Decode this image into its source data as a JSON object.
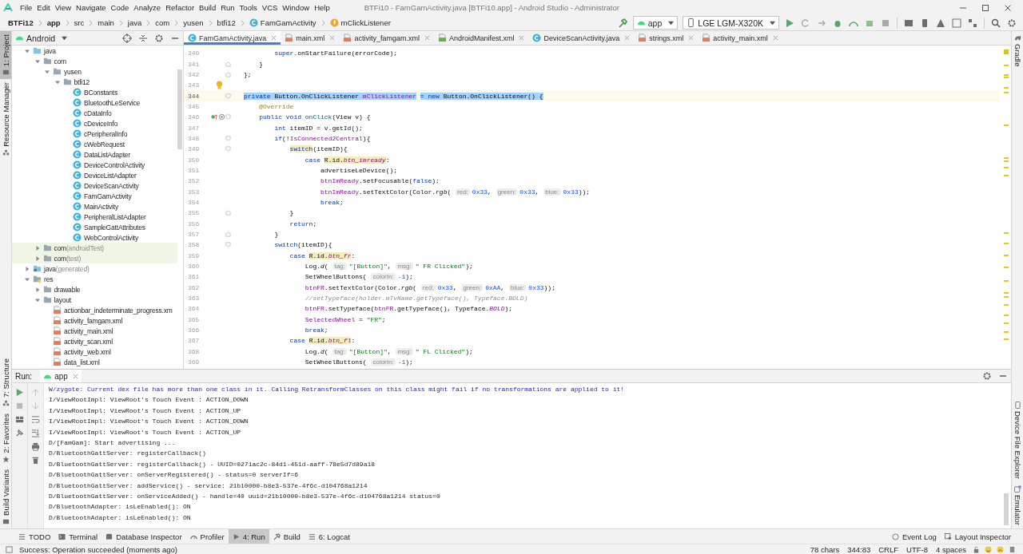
{
  "menu_bar": {
    "items": [
      "File",
      "Edit",
      "View",
      "Navigate",
      "Code",
      "Analyze",
      "Refactor",
      "Build",
      "Run",
      "Tools",
      "VCS",
      "Window",
      "Help"
    ],
    "title": "BTFi10 - FamGamActivity.java [BTFi10.app] - Android Studio - Administrator"
  },
  "navigation_bar": {
    "breadcrumbs": [
      {
        "label": "BTFi12",
        "kind": "bold"
      },
      {
        "label": "app",
        "kind": "bold"
      },
      {
        "label": "src",
        "kind": "plain"
      },
      {
        "label": "main",
        "kind": "plain"
      },
      {
        "label": "java",
        "kind": "plain"
      },
      {
        "label": "com",
        "kind": "plain"
      },
      {
        "label": "yusen",
        "kind": "plain"
      },
      {
        "label": "btfi12",
        "kind": "plain"
      },
      {
        "label": "FamGamActivity",
        "kind": "class"
      },
      {
        "label": "mClickListener",
        "kind": "field"
      }
    ],
    "run_config": "app",
    "device": "LGE LGM-X320K"
  },
  "left_stripe": {
    "top": [
      {
        "label": "1: Project",
        "kind": "project",
        "selected": true
      },
      {
        "label": "Resource Manager",
        "kind": "resources",
        "selected": false
      }
    ],
    "bottom": [
      {
        "label": "7: Structure",
        "kind": "structure",
        "selected": false
      },
      {
        "label": "2: Favorites",
        "kind": "favorites",
        "selected": false
      },
      {
        "label": "Build Variants",
        "kind": "build-variants",
        "selected": false
      }
    ]
  },
  "right_stripe": {
    "top": [
      {
        "label": "Gradle",
        "kind": "gradle",
        "selected": false
      }
    ],
    "bottom": [
      {
        "label": "Device File Explorer",
        "kind": "device-explorer",
        "selected": false
      },
      {
        "label": "Emulator",
        "kind": "emulator",
        "selected": false
      }
    ]
  },
  "project_panel": {
    "view": "Android",
    "tree": [
      {
        "label": "java",
        "kind": "source-folder",
        "expanded": true,
        "children": [
          {
            "label": "com",
            "kind": "package",
            "expanded": true,
            "children": [
              {
                "label": "yusen",
                "kind": "package",
                "expanded": true,
                "children": [
                  {
                    "label": "btfi12",
                    "kind": "package",
                    "expanded": true,
                    "children": [
                      {
                        "label": "BConstants",
                        "kind": "class"
                      },
                      {
                        "label": "BluetoothLeService",
                        "kind": "class"
                      },
                      {
                        "label": "cDataInfo",
                        "kind": "class"
                      },
                      {
                        "label": "cDeviceInfo",
                        "kind": "class"
                      },
                      {
                        "label": "cPeripheralInfo",
                        "kind": "class"
                      },
                      {
                        "label": "cWebRequest",
                        "kind": "class"
                      },
                      {
                        "label": "DataListAdapter",
                        "kind": "class"
                      },
                      {
                        "label": "DeviceControlActivity",
                        "kind": "class"
                      },
                      {
                        "label": "DeviceListAdapter",
                        "kind": "class"
                      },
                      {
                        "label": "DeviceScanActivity",
                        "kind": "class"
                      },
                      {
                        "label": "FamGamActivity",
                        "kind": "class"
                      },
                      {
                        "label": "MainActivity",
                        "kind": "class"
                      },
                      {
                        "label": "PeripheralListAdapter",
                        "kind": "class"
                      },
                      {
                        "label": "SampleGattAttributes",
                        "kind": "class"
                      },
                      {
                        "label": "WebControlActivity",
                        "kind": "class"
                      }
                    ]
                  }
                ]
              }
            ]
          },
          {
            "label": "com",
            "note": "(androidTest)",
            "kind": "test-package",
            "expanded": false
          },
          {
            "label": "com",
            "note": "(test)",
            "kind": "test-package",
            "expanded": false
          }
        ]
      },
      {
        "label": "java",
        "note": "(generated)",
        "kind": "generated-folder",
        "expanded": false
      },
      {
        "label": "res",
        "kind": "res-folder",
        "expanded": true,
        "children": [
          {
            "label": "drawable",
            "kind": "package",
            "expanded": false
          },
          {
            "label": "layout",
            "kind": "package",
            "expanded": true,
            "children": [
              {
                "label": "actionbar_indeterminate_progress.xm",
                "kind": "xml"
              },
              {
                "label": "activity_famgam.xml",
                "kind": "xml"
              },
              {
                "label": "activity_main.xml",
                "kind": "xml"
              },
              {
                "label": "activity_scan.xml",
                "kind": "xml"
              },
              {
                "label": "activity_web.xml",
                "kind": "xml"
              },
              {
                "label": "data_list.xml",
                "kind": "xml"
              }
            ]
          }
        ]
      }
    ]
  },
  "editor": {
    "tabs": [
      {
        "label": "FamGamActivity.java",
        "kind": "class",
        "selected": true
      },
      {
        "label": "main.xml",
        "kind": "xml",
        "selected": false
      },
      {
        "label": "activity_famgam.xml",
        "kind": "xml",
        "selected": false
      },
      {
        "label": "AndroidManifest.xml",
        "kind": "manifest",
        "selected": false
      },
      {
        "label": "DeviceScanActivity.java",
        "kind": "class",
        "selected": false
      },
      {
        "label": "strings.xml",
        "kind": "xml",
        "selected": false
      },
      {
        "label": "activity_main.xml",
        "kind": "xml",
        "selected": false
      }
    ],
    "lines": [
      {
        "num": "340",
        "selected": false,
        "tokens": [
          {
            "kind": "kw",
            "text": "        super"
          },
          {
            "kind": "p",
            "text": ".onStartFailure(errorCode);"
          }
        ]
      },
      {
        "num": "341",
        "selected": false,
        "gutter": [
          {
            "kind": "fold-end"
          }
        ],
        "tokens": [
          {
            "kind": "p",
            "text": "    }"
          }
        ]
      },
      {
        "num": "342",
        "selected": false,
        "gutter": [
          {
            "kind": "fold-end"
          }
        ],
        "tokens": [
          {
            "kind": "p",
            "text": "};"
          }
        ]
      },
      {
        "num": "343",
        "selected": false,
        "gutter": [
          {
            "kind": "bulb"
          }
        ]
      },
      {
        "num": "344",
        "selected": true,
        "gutter": [
          {
            "kind": "fold-start"
          }
        ],
        "tokens": [
          {
            "kind": "kw",
            "text": "private "
          },
          {
            "kind": "p",
            "text": "Button.OnClickListener "
          },
          {
            "kind": "fld",
            "text": "mClickListener"
          },
          {
            "kind": "p",
            "text": " = "
          },
          {
            "kind": "kw",
            "text": "new "
          },
          {
            "kind": "p",
            "text": "Button.OnClickListener() {"
          }
        ]
      },
      {
        "num": "345",
        "selected": false,
        "tokens": [
          {
            "kind": "ann",
            "text": "    @Override"
          }
        ]
      },
      {
        "num": "346",
        "selected": false,
        "gutter": [
          {
            "kind": "override"
          },
          {
            "kind": "fold-start"
          }
        ],
        "tokens": [
          {
            "kind": "kw",
            "text": "    public void "
          },
          {
            "kind": "mth",
            "text": "onClick"
          },
          {
            "kind": "p",
            "text": "(View v) {"
          }
        ]
      },
      {
        "num": "347",
        "selected": false,
        "tokens": [
          {
            "kind": "kw",
            "text": "        int "
          },
          {
            "kind": "p",
            "text": "itemID = v.getId();"
          }
        ]
      },
      {
        "num": "348",
        "selected": false,
        "gutter": [
          {
            "kind": "fold-start"
          }
        ],
        "tokens": [
          {
            "kind": "kw",
            "text": "        if"
          },
          {
            "kind": "p",
            "text": "(!"
          },
          {
            "kind": "fld",
            "text": "IsConnected2Central"
          },
          {
            "kind": "p",
            "text": "){"
          }
        ]
      },
      {
        "num": "349",
        "selected": false,
        "gutter": [
          {
            "kind": "fold-start"
          }
        ],
        "tokens": [
          {
            "kind": "kwhl",
            "text": "            switch"
          },
          {
            "kind": "p",
            "text": "(itemID){"
          }
        ]
      },
      {
        "num": "350",
        "selected": false,
        "tokens": [
          {
            "kind": "kw",
            "text": "                case "
          },
          {
            "kind": "hl",
            "text": "R.id."
          },
          {
            "kind": "hlit",
            "text": "btn_imready"
          },
          {
            "kind": "p",
            "text": ":"
          }
        ]
      },
      {
        "num": "351",
        "selected": false,
        "tokens": [
          {
            "kind": "p",
            "text": "                    advertiseLeDevice();"
          }
        ]
      },
      {
        "num": "352",
        "selected": false,
        "tokens": [
          {
            "kind": "fld",
            "text": "                    btnImReady"
          },
          {
            "kind": "p",
            "text": ".setFocusable("
          },
          {
            "kind": "kw",
            "text": "false"
          },
          {
            "kind": "p",
            "text": ");"
          }
        ]
      },
      {
        "num": "353",
        "selected": false,
        "tokens": [
          {
            "kind": "fld",
            "text": "                    btnImReady"
          },
          {
            "kind": "p",
            "text": ".setTextColor(Color."
          },
          {
            "kind": "it",
            "text": "rgb"
          },
          {
            "kind": "p",
            "text": "( "
          },
          {
            "kind": "hint",
            "text": "red:"
          },
          {
            "kind": "num",
            "text": "0x33"
          },
          {
            "kind": "p",
            "text": ", "
          },
          {
            "kind": "hint",
            "text": "green:"
          },
          {
            "kind": "num",
            "text": "0x33"
          },
          {
            "kind": "p",
            "text": ", "
          },
          {
            "kind": "hint",
            "text": "blue:"
          },
          {
            "kind": "num",
            "text": "0x33"
          },
          {
            "kind": "p",
            "text": "));"
          }
        ]
      },
      {
        "num": "354",
        "selected": false,
        "tokens": [
          {
            "kind": "kw",
            "text": "                    break"
          },
          {
            "kind": "p",
            "text": ";"
          }
        ]
      },
      {
        "num": "355",
        "selected": false,
        "gutter": [
          {
            "kind": "fold-end"
          }
        ],
        "tokens": [
          {
            "kind": "p",
            "text": "            }"
          }
        ]
      },
      {
        "num": "356",
        "selected": false,
        "tokens": [
          {
            "kind": "kw",
            "text": "            return"
          },
          {
            "kind": "p",
            "text": ";"
          }
        ]
      },
      {
        "num": "357",
        "selected": false,
        "gutter": [
          {
            "kind": "fold-end"
          }
        ],
        "tokens": [
          {
            "kind": "p",
            "text": "        }"
          }
        ]
      },
      {
        "num": "358",
        "selected": false,
        "gutter": [
          {
            "kind": "fold-start"
          }
        ],
        "tokens": [
          {
            "kind": "kw",
            "text": "        switch"
          },
          {
            "kind": "p",
            "text": "(itemID){"
          }
        ]
      },
      {
        "num": "359",
        "selected": false,
        "tokens": [
          {
            "kind": "kw",
            "text": "            case "
          },
          {
            "kind": "hl",
            "text": "R.id."
          },
          {
            "kind": "hlit",
            "text": "btn_fr"
          },
          {
            "kind": "p",
            "text": ":"
          }
        ]
      },
      {
        "num": "360",
        "selected": false,
        "tokens": [
          {
            "kind": "p",
            "text": "                Log."
          },
          {
            "kind": "it",
            "text": "d"
          },
          {
            "kind": "p",
            "text": "( "
          },
          {
            "kind": "hint",
            "text": "tag:"
          },
          {
            "kind": "str",
            "text": "\"[Button]\""
          },
          {
            "kind": "p",
            "text": ", "
          },
          {
            "kind": "hint",
            "text": "msg:"
          },
          {
            "kind": "str",
            "text": "\" FR Clicked\""
          },
          {
            "kind": "p",
            "text": ");"
          }
        ]
      },
      {
        "num": "361",
        "selected": false,
        "tokens": [
          {
            "kind": "p",
            "text": "                SetWheelButtons( "
          },
          {
            "kind": "hint",
            "text": "colorIn:"
          },
          {
            "kind": "num",
            "text": "-1"
          },
          {
            "kind": "p",
            "text": ");"
          }
        ]
      },
      {
        "num": "362",
        "selected": false,
        "tokens": [
          {
            "kind": "fld",
            "text": "                btnFR"
          },
          {
            "kind": "p",
            "text": ".setTextColor(Color."
          },
          {
            "kind": "it",
            "text": "rgb"
          },
          {
            "kind": "p",
            "text": "( "
          },
          {
            "kind": "hint",
            "text": "red:"
          },
          {
            "kind": "num",
            "text": "0x33"
          },
          {
            "kind": "p",
            "text": ", "
          },
          {
            "kind": "hint",
            "text": "green:"
          },
          {
            "kind": "num",
            "text": "0xAA"
          },
          {
            "kind": "p",
            "text": ", "
          },
          {
            "kind": "hint",
            "text": "blue:"
          },
          {
            "kind": "num",
            "text": "0x33"
          },
          {
            "kind": "p",
            "text": "));"
          }
        ]
      },
      {
        "num": "363",
        "selected": false,
        "tokens": [
          {
            "kind": "cm",
            "text": "                //setTypeface(holder.mTvName.getTypeface(), Typeface.BOLD)"
          }
        ]
      },
      {
        "num": "364",
        "selected": false,
        "tokens": [
          {
            "kind": "fld",
            "text": "                btnFR"
          },
          {
            "kind": "p",
            "text": ".setTypeface("
          },
          {
            "kind": "fld",
            "text": "btnFR"
          },
          {
            "kind": "p",
            "text": ".getTypeface(), Typeface."
          },
          {
            "kind": "itf",
            "text": "BOLD"
          },
          {
            "kind": "p",
            "text": ");"
          }
        ]
      },
      {
        "num": "365",
        "selected": false,
        "tokens": [
          {
            "kind": "fld",
            "text": "                SelectedWheel"
          },
          {
            "kind": "p",
            "text": " = "
          },
          {
            "kind": "str",
            "text": "\"FR\""
          },
          {
            "kind": "p",
            "text": ";"
          }
        ]
      },
      {
        "num": "366",
        "selected": false,
        "tokens": [
          {
            "kind": "kw",
            "text": "                break"
          },
          {
            "kind": "p",
            "text": ";"
          }
        ]
      },
      {
        "num": "367",
        "selected": false,
        "tokens": [
          {
            "kind": "kw",
            "text": "            case "
          },
          {
            "kind": "hl",
            "text": "R.id."
          },
          {
            "kind": "hlit",
            "text": "btn_fl"
          },
          {
            "kind": "p",
            "text": ":"
          }
        ]
      },
      {
        "num": "368",
        "selected": false,
        "tokens": [
          {
            "kind": "p",
            "text": "                Log."
          },
          {
            "kind": "it",
            "text": "d"
          },
          {
            "kind": "p",
            "text": "( "
          },
          {
            "kind": "hint",
            "text": "tag:"
          },
          {
            "kind": "str",
            "text": "\"[Button]\""
          },
          {
            "kind": "p",
            "text": ", "
          },
          {
            "kind": "hint",
            "text": "msg:"
          },
          {
            "kind": "str",
            "text": "\" FL Clicked\""
          },
          {
            "kind": "p",
            "text": ");"
          }
        ]
      },
      {
        "num": "369",
        "selected": false,
        "tokens": [
          {
            "kind": "p",
            "text": "                SetWheelButtons( "
          },
          {
            "kind": "hint",
            "text": "colorIn:"
          },
          {
            "kind": "num",
            "text": "-1"
          },
          {
            "kind": "p",
            "text": ");"
          }
        ]
      }
    ]
  },
  "run_panel": {
    "title": "Run:",
    "tab": "app",
    "lines": [
      {
        "kind": "warning",
        "text": "W/zygote: Current dex file has more than one class in it. Calling RetransformClasses on this class might fail if no transformations are applied to it!"
      },
      {
        "kind": "normal",
        "text": "I/ViewRootImpl: ViewRoot's Touch Event : ACTION_DOWN"
      },
      {
        "kind": "normal",
        "text": "I/ViewRootImpl: ViewRoot's Touch Event : ACTION_UP"
      },
      {
        "kind": "normal",
        "text": "I/ViewRootImpl: ViewRoot's Touch Event : ACTION_DOWN"
      },
      {
        "kind": "normal",
        "text": "I/ViewRootImpl: ViewRoot's Touch Event : ACTION_UP"
      },
      {
        "kind": "normal",
        "text": "D/[FamGam]: Start advertising ..."
      },
      {
        "kind": "normal",
        "text": "D/BluetoothGattServer: registerCallback()"
      },
      {
        "kind": "normal",
        "text": "D/BluetoothGattServer: registerCallback() - UUID=0271ac2c-84d1-451d-aaff-78e5d7d89a18"
      },
      {
        "kind": "normal",
        "text": "D/BluetoothGattServer: onServerRegistered() - status=0 serverIf=6"
      },
      {
        "kind": "normal",
        "text": "D/BluetoothGattServer: addService() - service: 21b10000-b8e3-537e-4f6c-d104768a1214"
      },
      {
        "kind": "normal",
        "text": "D/BluetoothGattServer: onServiceAdded() - handle=40 uuid=21b10000-b8e3-537e-4f6c-d104768a1214 status=0"
      },
      {
        "kind": "normal",
        "text": "D/BluetoothAdapter: isLeEnabled(): ON"
      },
      {
        "kind": "normal",
        "text": "D/BluetoothAdapter: isLeEnabled(): ON"
      }
    ]
  },
  "tool_windows_bar": {
    "left": [
      {
        "label": "TODO",
        "kind": "todo",
        "selected": false
      },
      {
        "label": "Terminal",
        "kind": "terminal",
        "selected": false
      },
      {
        "label": "Database Inspector",
        "kind": "database",
        "selected": false
      },
      {
        "label": "Profiler",
        "kind": "profiler",
        "selected": false
      },
      {
        "label": "4: Run",
        "kind": "run",
        "selected": true
      },
      {
        "label": "Build",
        "kind": "build",
        "selected": false
      },
      {
        "label": "6: Logcat",
        "kind": "logcat",
        "selected": false
      }
    ],
    "right": [
      {
        "label": "Event Log",
        "kind": "event-log",
        "selected": false
      },
      {
        "label": "Layout Inspector",
        "kind": "layout-inspector",
        "selected": false
      }
    ]
  },
  "status_bar": {
    "message": "Success: Operation succeeded (moments ago)",
    "items": [
      "78 chars",
      "344:83",
      "CRLF",
      "UTF-8",
      "4 spaces"
    ]
  }
}
